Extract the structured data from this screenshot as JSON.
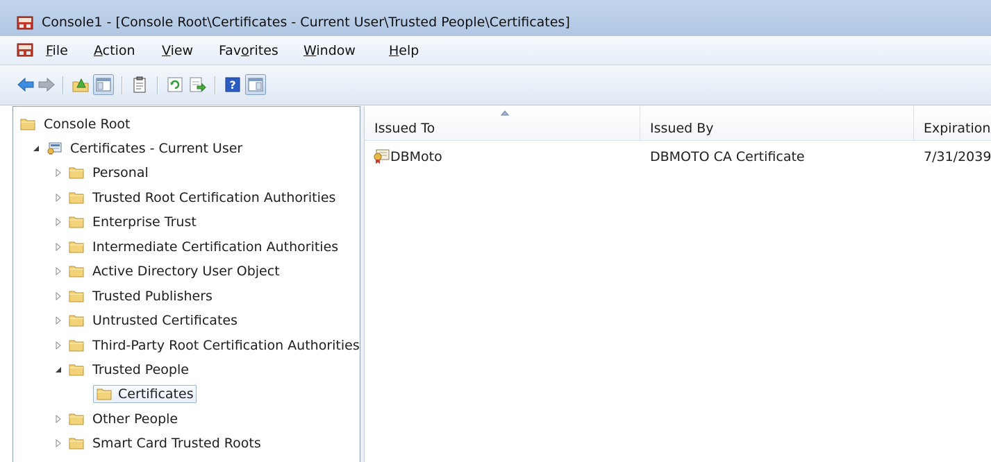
{
  "window": {
    "title": "Console1 - [Console Root\\Certificates - Current User\\Trusted People\\Certificates]"
  },
  "menu": [
    {
      "pre": "",
      "ul": "F",
      "post": "ile"
    },
    {
      "pre": "",
      "ul": "A",
      "post": "ction"
    },
    {
      "pre": "",
      "ul": "V",
      "post": "iew"
    },
    {
      "pre": "Fav",
      "ul": "o",
      "post": "rites"
    },
    {
      "pre": "",
      "ul": "W",
      "post": "indow"
    },
    {
      "pre": "",
      "ul": "H",
      "post": "elp"
    }
  ],
  "toolbar": {
    "buttons": [
      "back-arrow-icon",
      "forward-arrow-icon",
      "up-folder-icon",
      "show-hide-console-tree-icon",
      "clipboard-icon",
      "refresh-icon",
      "export-list-icon",
      "help-icon",
      "show-hide-action-pane-icon"
    ]
  },
  "tree": {
    "root": "Console Root",
    "store": "Certificates - Current User",
    "items": [
      "Personal",
      "Trusted Root Certification Authorities",
      "Enterprise Trust",
      "Intermediate Certification Authorities",
      "Active Directory User Object",
      "Trusted Publishers",
      "Untrusted Certificates",
      "Third-Party Root Certification Authorities",
      "Trusted People",
      "Certificates",
      "Other People",
      "Smart Card Trusted Roots"
    ]
  },
  "list": {
    "columns": [
      "Issued To",
      "Issued By",
      "Expiration Date"
    ],
    "rows": [
      {
        "issued_to": "DBMoto",
        "issued_by": "DBMOTO CA Certificate",
        "expiration": "7/31/2039"
      }
    ]
  },
  "colors": {
    "title_bar": "#b7cce6",
    "menu_bar": "#eef3fa",
    "toolbar": "#e6edf6",
    "folder": "#f2d37a",
    "selection_border": "#9fb4cf"
  }
}
